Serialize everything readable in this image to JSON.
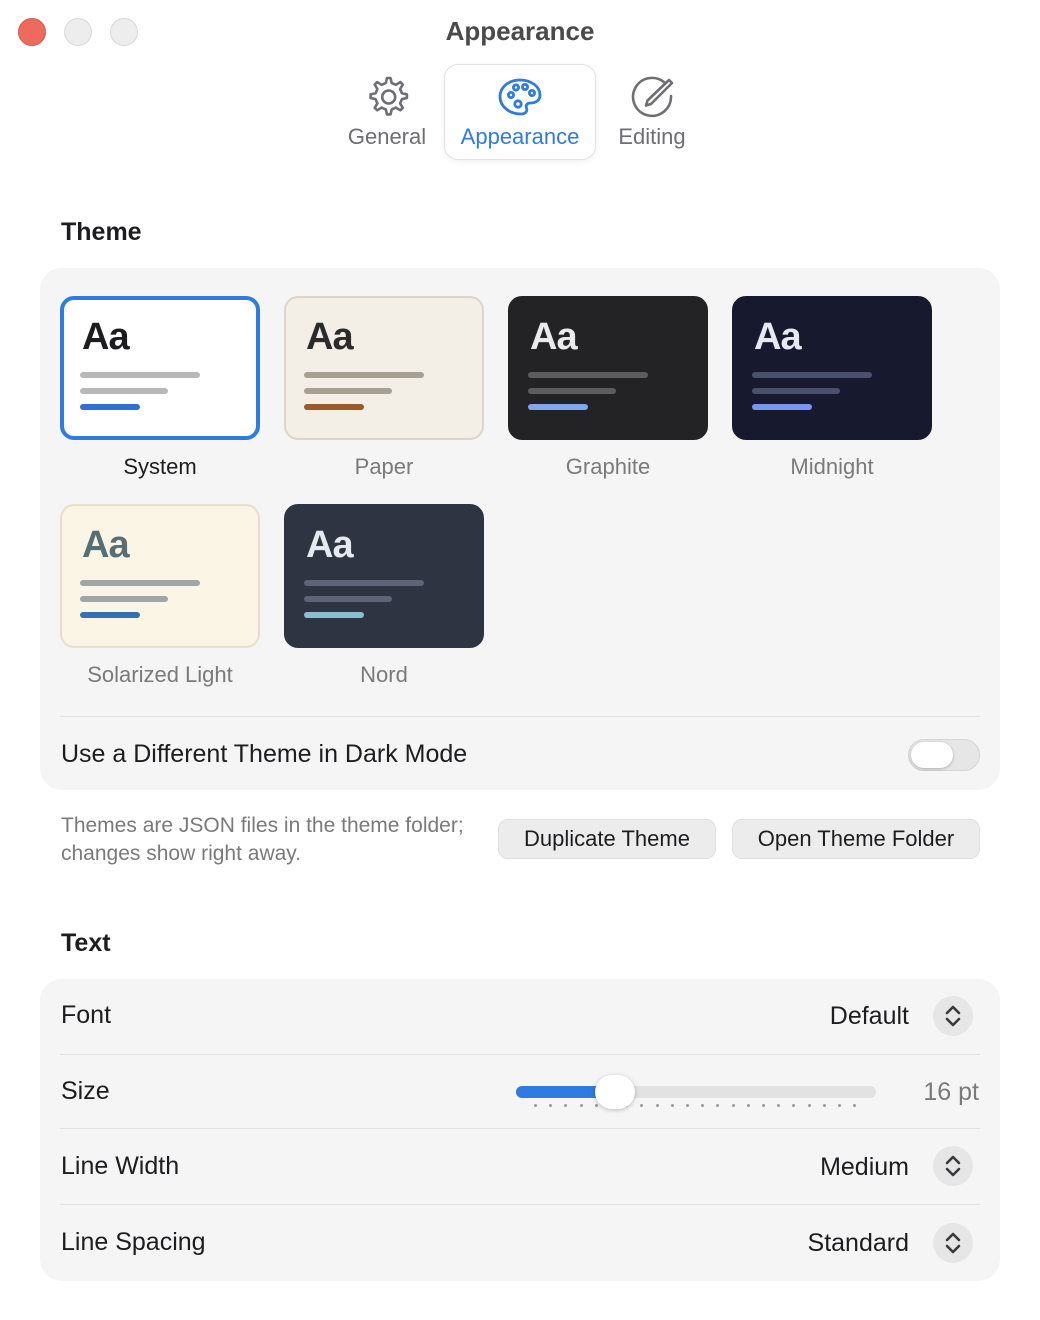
{
  "window": {
    "title": "Appearance"
  },
  "toolbar": {
    "tabs": [
      {
        "label": "General",
        "icon": "gear-icon"
      },
      {
        "label": "Appearance",
        "icon": "palette-icon",
        "active": true
      },
      {
        "label": "Editing",
        "icon": "pencil-circle-icon"
      }
    ]
  },
  "theme_section": {
    "title": "Theme",
    "sample_text": "Aa",
    "themes": [
      {
        "name": "System",
        "selected": true,
        "bg": "#ffffff",
        "border": "#2f7be0",
        "text": "#1d1d1f",
        "line": "#b8b8b8",
        "accent": "#2f6fd8"
      },
      {
        "name": "Paper",
        "bg": "#f3efe6",
        "border": "#dcd6ca",
        "text": "#2b2b2b",
        "line": "#a7a094",
        "accent": "#9a5a2c"
      },
      {
        "name": "Graphite",
        "bg": "#232325",
        "border": "#232325",
        "text": "#ebebeb",
        "line": "#5c5c60",
        "accent": "#7fa6ef"
      },
      {
        "name": "Midnight",
        "bg": "#171a2e",
        "border": "#171a2e",
        "text": "#e6e8f2",
        "line": "#4a4f6a",
        "accent": "#7a95f0"
      },
      {
        "name": "Solarized Light",
        "bg": "#fbf5e6",
        "border": "#e6dfc9",
        "text": "#586e75",
        "line": "#9fa6a6",
        "accent": "#3371b5"
      },
      {
        "name": "Nord",
        "bg": "#2e3441",
        "border": "#2e3441",
        "text": "#e5e9f0",
        "line": "#5d6577",
        "accent": "#88c0d0"
      }
    ],
    "dark_mode_label": "Use a Different Theme in Dark Mode",
    "dark_mode_enabled": false,
    "hint": "Themes are JSON files in the theme folder; changes show right away.",
    "duplicate_button": "Duplicate Theme",
    "open_folder_button": "Open Theme Folder"
  },
  "text_section": {
    "title": "Text",
    "font": {
      "label": "Font",
      "value": "Default"
    },
    "size": {
      "label": "Size",
      "value_text": "16 pt",
      "fraction": 0.27
    },
    "line_width": {
      "label": "Line Width",
      "value": "Medium"
    },
    "line_spacing": {
      "label": "Line Spacing",
      "value": "Standard"
    }
  },
  "colors": {
    "accent": "#2f7be0",
    "close": "#ec6a5e"
  }
}
